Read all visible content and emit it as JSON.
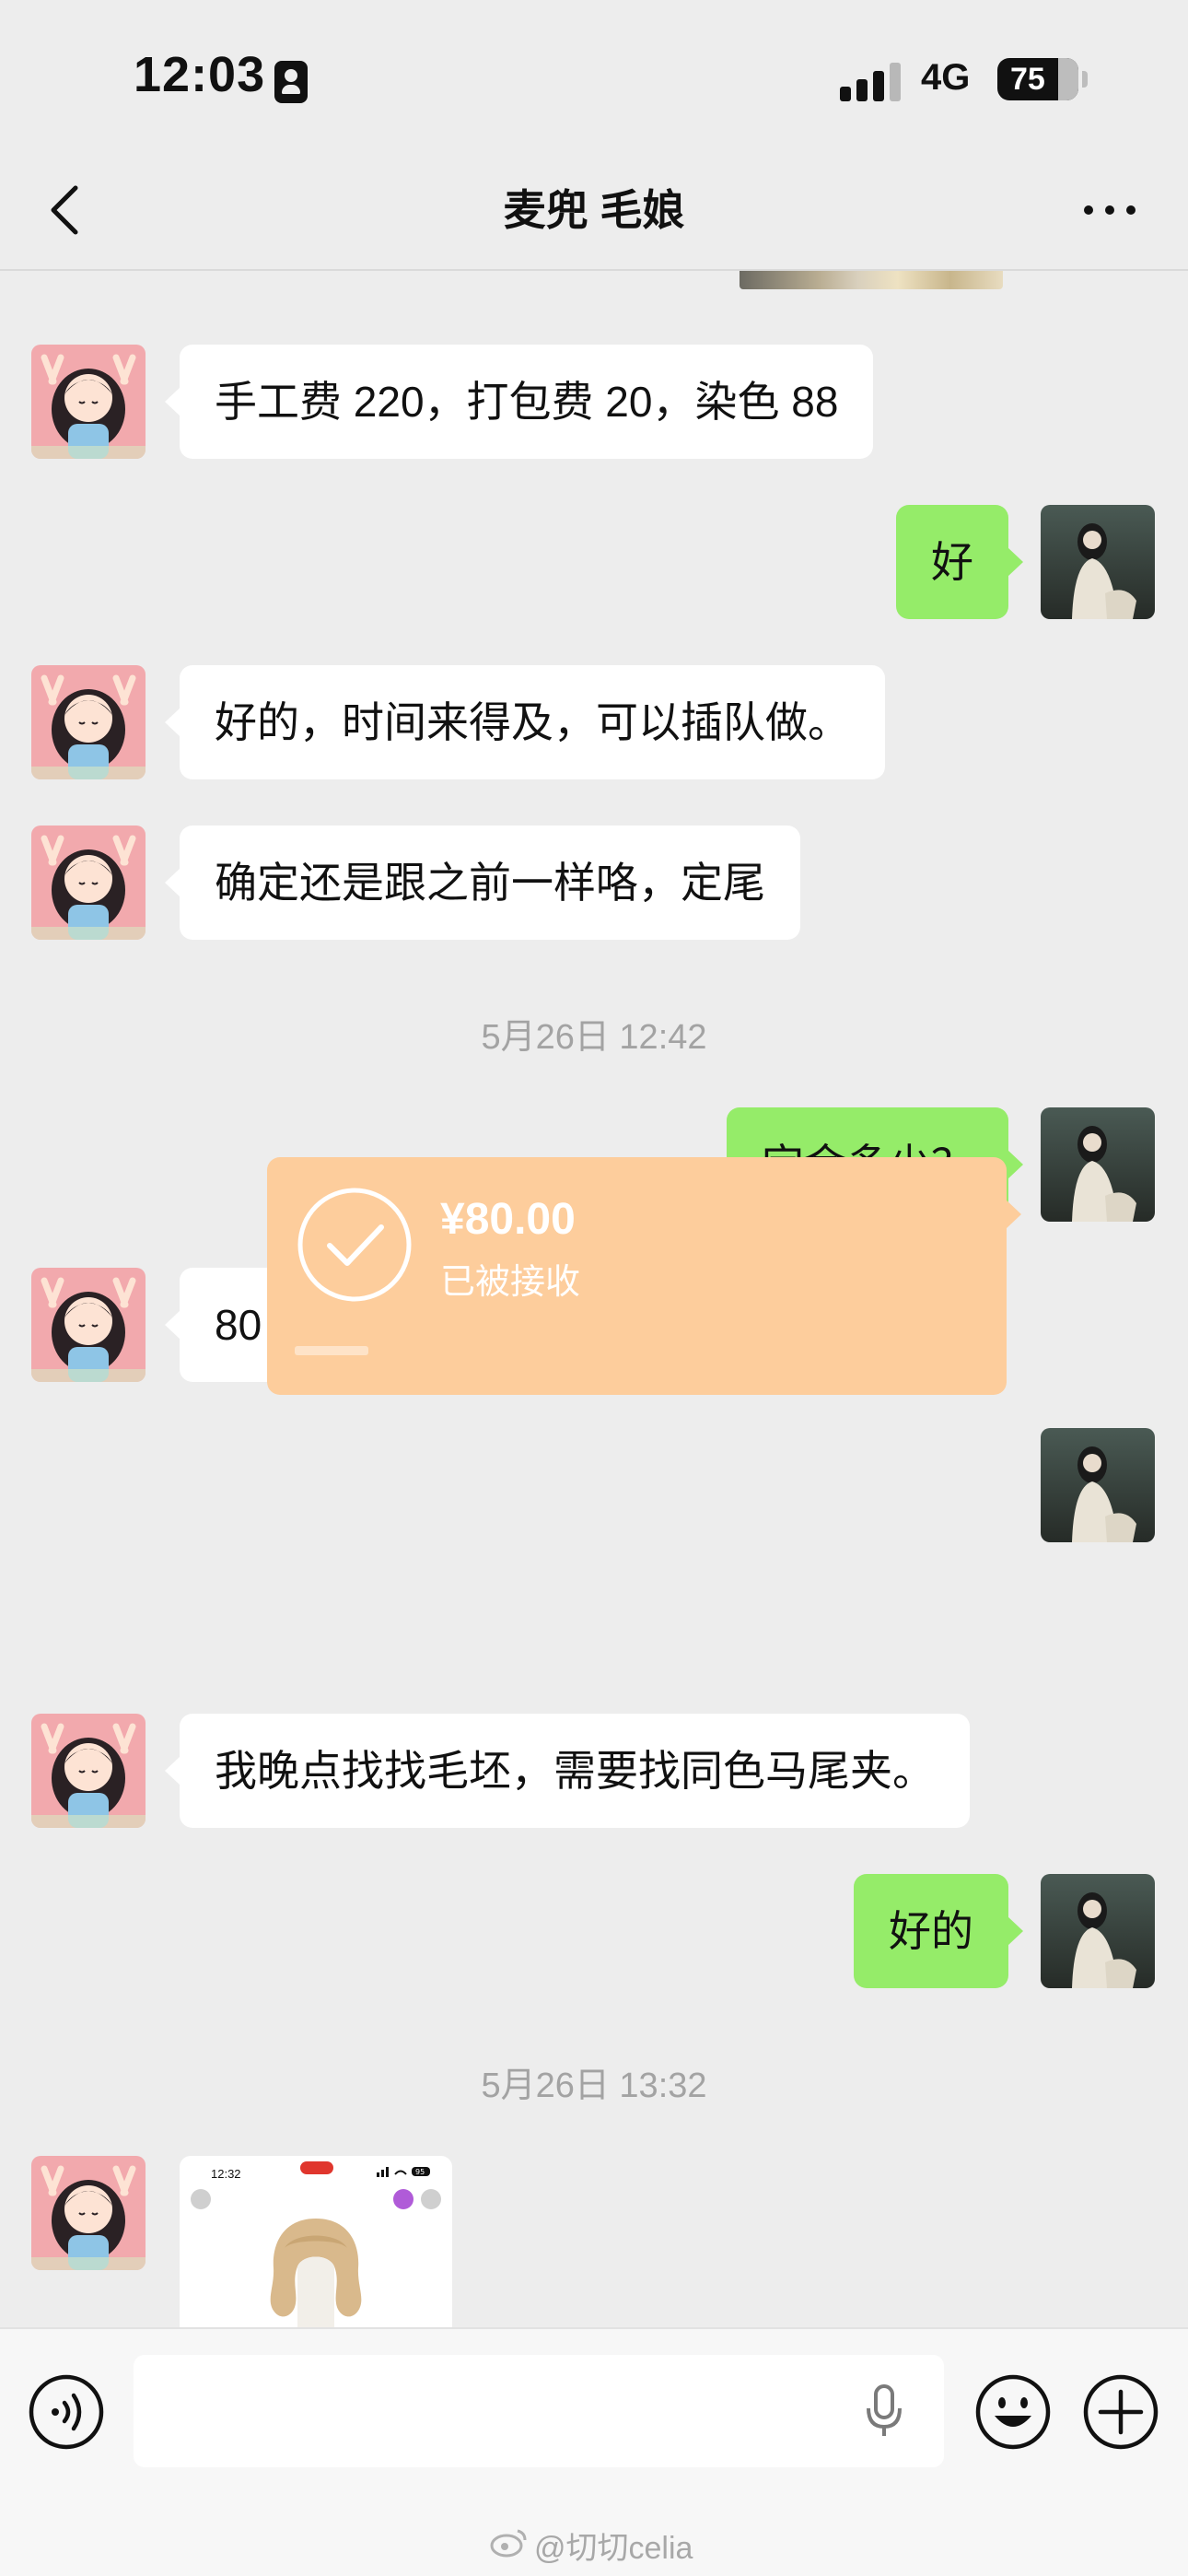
{
  "status_bar": {
    "time": "12:03",
    "network": "4G",
    "battery": "75",
    "icons": [
      "contact-card-icon",
      "signal-bars-icon",
      "battery-icon"
    ]
  },
  "nav": {
    "title": "麦兜 毛娘",
    "icons": [
      "back-chevron-icon",
      "more-dots-icon"
    ]
  },
  "messages": [
    {
      "side": "in",
      "type": "text",
      "text": "手工费 220，打包费 20，染色 88"
    },
    {
      "side": "out",
      "type": "text",
      "text": "好"
    },
    {
      "side": "in",
      "type": "text",
      "text": "好的，时间来得及，可以插队做。"
    },
    {
      "side": "in",
      "type": "text",
      "text": "确定还是跟之前一样咯，定尾"
    },
    {
      "type": "timestamp",
      "text": "5月26日 12:42"
    },
    {
      "side": "out",
      "type": "text",
      "text": "定金多少？"
    },
    {
      "side": "in",
      "type": "text",
      "text": "80"
    },
    {
      "side": "out",
      "type": "transfer",
      "amount": "¥80.00",
      "status": "已被接收"
    },
    {
      "side": "in",
      "type": "text",
      "text": "我晚点找找毛坯，需要找同色马尾夹。"
    },
    {
      "side": "out",
      "type": "text",
      "text": "好的"
    },
    {
      "type": "timestamp",
      "text": "5月26日 13:32"
    },
    {
      "side": "in",
      "type": "image",
      "inner_time": "12:32",
      "inner_battery": "95"
    }
  ],
  "input_bar": {
    "placeholder": "",
    "icons": [
      "voice-icon",
      "microphone-icon",
      "emoji-icon",
      "plus-icon"
    ]
  },
  "watermark": "@切切celia",
  "colors": {
    "background": "#ededed",
    "bubble_out": "#95ec69",
    "bubble_in": "#ffffff",
    "transfer": "#fdcd9c",
    "timestamp": "#a3a3a3"
  }
}
